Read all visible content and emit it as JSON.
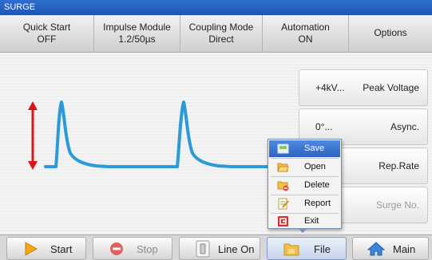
{
  "window": {
    "title": "SURGE"
  },
  "header": {
    "quick_start": {
      "label": "Quick Start",
      "value": "OFF"
    },
    "impulse_module": {
      "label": "Impulse Module",
      "value": "1.2/50µs"
    },
    "coupling_mode": {
      "label": "Coupling Mode",
      "value": "Direct"
    },
    "automation": {
      "label": "Automation",
      "value": "ON"
    },
    "options": {
      "label": "Options"
    }
  },
  "right_panel": {
    "peak_voltage": {
      "value": "+4kV...",
      "label": "Peak Voltage"
    },
    "phase": {
      "value": "0°...",
      "label": "Async."
    },
    "rep_rate": {
      "label": "Rep.Rate"
    },
    "surge_no": {
      "label": "Surge No."
    }
  },
  "file_menu": {
    "items": [
      {
        "label": "Save",
        "icon": "save-icon",
        "selected": true
      },
      {
        "label": "Open",
        "icon": "folder-open-icon"
      },
      {
        "label": "Delete",
        "icon": "delete-icon"
      },
      {
        "label": "Report",
        "icon": "report-icon"
      },
      {
        "label": "Exit",
        "icon": "exit-icon"
      }
    ]
  },
  "bottom_bar": {
    "start": "Start",
    "stop": "Stop",
    "line_on": "Line On",
    "file": "File",
    "main": "Main"
  },
  "colors": {
    "title_bar": "#2f6fd0",
    "waveform": "#2a9ad8",
    "amplitude_arrow": "#d9141b",
    "menu_selected": "#3a74d0"
  }
}
